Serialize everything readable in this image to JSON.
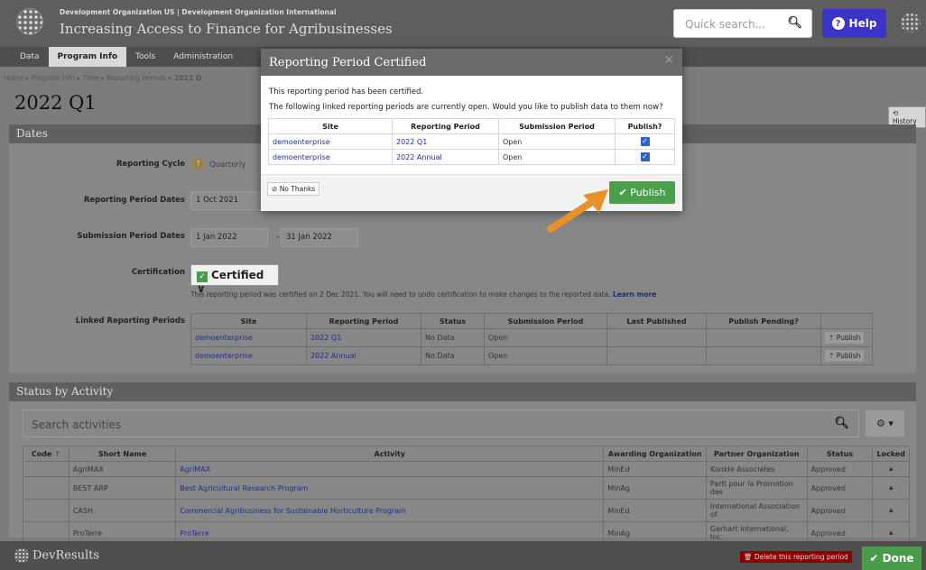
{
  "header": {
    "org": "Development Organization US | Development Organization International",
    "program": "Increasing Access to Finance for Agribusinesses",
    "search_placeholder": "Quick search...",
    "help": "Help"
  },
  "nav": [
    "Data",
    "Program Info",
    "Tools",
    "Administration"
  ],
  "breadcrumb": [
    "Home",
    "Program Info",
    "Time",
    "Reporting Periods",
    "2022 Q"
  ],
  "page_title": "2022 Q1",
  "history": "History",
  "dates": {
    "heading": "Dates",
    "reporting_cycle_label": "Reporting Cycle",
    "reporting_cycle": "Quarterly",
    "rp_dates_label": "Reporting Period Dates",
    "rp_start": "1 Oct 2021",
    "sp_dates_label": "Submission Period Dates",
    "sp_start": "1 Jan 2022",
    "sp_end": "31 Jan 2022",
    "sp_sep": "-",
    "cert_label": "Certification",
    "cert_value": "Certified",
    "cert_note": "This reporting period was certified on 2 Dec 2021. You will need to undo certification to make changes to the reported data.",
    "learn_more": "Learn more",
    "linked_label": "Linked Reporting Periods",
    "linked_cols": [
      "Site",
      "Reporting Period",
      "Status",
      "Submission Period",
      "Last Published",
      "Publish Pending?",
      ""
    ],
    "linked_rows": [
      [
        "demoenterprise",
        "2022 Q1",
        "No Data",
        "Open",
        "",
        "",
        "Publish"
      ],
      [
        "demoenterprise",
        "2022 Annual",
        "No Data",
        "Open",
        "",
        "",
        "Publish"
      ]
    ]
  },
  "activity": {
    "heading": "Status by Activity",
    "search_placeholder": "Search activities",
    "cols": [
      "Code",
      "Short Name",
      "Activity",
      "Awarding Organization",
      "Partner Organization",
      "Status",
      "Locked"
    ],
    "rows": [
      [
        "",
        "AgriMAX",
        "AgriMAX",
        "MinEd",
        "Kunkle Associates",
        "Approved"
      ],
      [
        "",
        "BEST ARP",
        "Best Agricultural Research Program",
        "MinAg",
        "Parti pour la Promotion des",
        "Approved"
      ],
      [
        "",
        "CASH",
        "Commercial Agribusiness for Sustainable Horticulture Program",
        "MinEd",
        "International Association of",
        "Approved"
      ],
      [
        "",
        "ProTerre",
        "ProTerre",
        "MinAg",
        "Gerhart International, Inc.",
        "Approved"
      ]
    ]
  },
  "footer": {
    "brand": "DevResults",
    "delete": "Delete this reporting period",
    "done": "Done"
  },
  "modal": {
    "title": "Reporting Period Certified",
    "line1": "This reporting period has been certified.",
    "line2": "The following linked reporting periods are currently open. Would you like to publish data to them now?",
    "cols": [
      "Site",
      "Reporting Period",
      "Submission Period",
      "Publish?"
    ],
    "rows": [
      [
        "demoenterprise",
        "2022 Q1",
        "Open"
      ],
      [
        "demoenterprise",
        "2022 Annual",
        "Open"
      ]
    ],
    "no_thanks": "No Thanks",
    "publish": "Publish"
  },
  "colors": {
    "accent": "#4aa04a",
    "help": "#3b34c9",
    "arrow": "#e8912a",
    "delete": "#8b0000"
  }
}
